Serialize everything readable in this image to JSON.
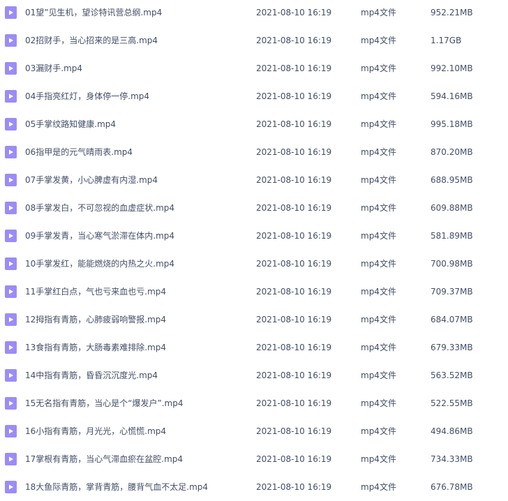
{
  "colors": {
    "icon_bg": "#9b8cf7",
    "icon_play": "#ffffff",
    "text": "#424e67"
  },
  "files": [
    {
      "icon": "video-file-icon",
      "name": "01望”见生机，望诊特讯营总纲.mp4",
      "date": "2021-08-10 16:19",
      "type": "mp4文件",
      "size": "952.21MB"
    },
    {
      "icon": "video-file-icon",
      "name": "02招财手，当心招来的是三高.mp4",
      "date": "2021-08-10 16:19",
      "type": "mp4文件",
      "size": "1.17GB"
    },
    {
      "icon": "video-file-icon",
      "name": "03漏财手.mp4",
      "date": "2021-08-10 16:19",
      "type": "mp4文件",
      "size": "992.10MB"
    },
    {
      "icon": "video-file-icon",
      "name": "04手指亮红灯，身体停一停.mp4",
      "date": "2021-08-10 16:19",
      "type": "mp4文件",
      "size": "594.16MB"
    },
    {
      "icon": "video-file-icon",
      "name": "05手掌纹路知健康.mp4",
      "date": "2021-08-10 16:19",
      "type": "mp4文件",
      "size": "995.18MB"
    },
    {
      "icon": "video-file-icon",
      "name": "06指甲是的元气晴雨表.mp4",
      "date": "2021-08-10 16:19",
      "type": "mp4文件",
      "size": "870.20MB"
    },
    {
      "icon": "video-file-icon",
      "name": "07手掌发黄，小心脾虚有内湿.mp4",
      "date": "2021-08-10 16:19",
      "type": "mp4文件",
      "size": "688.95MB"
    },
    {
      "icon": "video-file-icon",
      "name": "08手掌发白，不可忽视的血虚症状.mp4",
      "date": "2021-08-10 16:19",
      "type": "mp4文件",
      "size": "609.88MB"
    },
    {
      "icon": "video-file-icon",
      "name": "09手掌发青，当心寒气淤滞在体内.mp4",
      "date": "2021-08-10 16:19",
      "type": "mp4文件",
      "size": "581.89MB"
    },
    {
      "icon": "video-file-icon",
      "name": "10手掌发红，能能燃烧的内热之火.mp4",
      "date": "2021-08-10 16:19",
      "type": "mp4文件",
      "size": "700.98MB"
    },
    {
      "icon": "video-file-icon",
      "name": "11手掌红白点，气也亏来血也亏.mp4",
      "date": "2021-08-10 16:19",
      "type": "mp4文件",
      "size": "709.37MB"
    },
    {
      "icon": "video-file-icon",
      "name": "12拇指有青筋，心肺疲弱响警报.mp4",
      "date": "2021-08-10 16:19",
      "type": "mp4文件",
      "size": "684.07MB"
    },
    {
      "icon": "video-file-icon",
      "name": "13食指有青筋，大肠毒素难排除.mp4",
      "date": "2021-08-10 16:19",
      "type": "mp4文件",
      "size": "679.33MB"
    },
    {
      "icon": "video-file-icon",
      "name": "14中指有青筋，昏昏沉沉度光.mp4",
      "date": "2021-08-10 16:19",
      "type": "mp4文件",
      "size": "563.52MB"
    },
    {
      "icon": "video-file-icon",
      "name": "15无名指有青筋，当心是个“爆发户”.mp4",
      "date": "2021-08-10 16:19",
      "type": "mp4文件",
      "size": "522.55MB"
    },
    {
      "icon": "video-file-icon",
      "name": "16小指有青筋，月光光，心慌慌.mp4",
      "date": "2021-08-10 16:19",
      "type": "mp4文件",
      "size": "494.86MB"
    },
    {
      "icon": "video-file-icon",
      "name": "17掌根有青筋，当心气滞血瘀在盆腔.mp4",
      "date": "2021-08-10 16:19",
      "type": "mp4文件",
      "size": "734.33MB"
    },
    {
      "icon": "video-file-icon",
      "name": "18大鱼际青筋，掌背青筋，腰背气血不太足.mp4",
      "date": "2021-08-10 16:19",
      "type": "mp4文件",
      "size": "676.78MB"
    }
  ]
}
